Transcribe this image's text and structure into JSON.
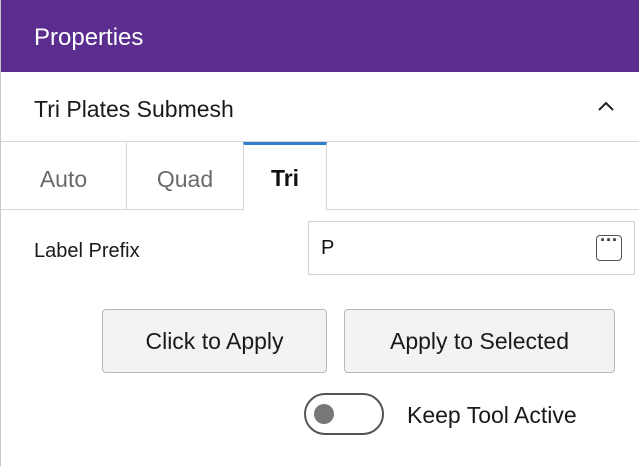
{
  "header": {
    "title": "Properties"
  },
  "section": {
    "title": "Tri Plates Submesh",
    "collapse_icon": "chevron-up-icon"
  },
  "tabs": [
    {
      "label": "Auto",
      "active": false
    },
    {
      "label": "Quad",
      "active": false
    },
    {
      "label": "Tri",
      "active": true
    }
  ],
  "fields": {
    "label_prefix": {
      "label": "Label Prefix",
      "value": "P",
      "button_icon": "ellipsis-icon"
    }
  },
  "buttons": {
    "click_to_apply": "Click to Apply",
    "apply_to_selected": "Apply to Selected"
  },
  "toggle": {
    "label": "Keep Tool Active",
    "on": false
  },
  "colors": {
    "header_bg": "#5b2d8f",
    "tab_active_accent": "#2f7fd1"
  }
}
